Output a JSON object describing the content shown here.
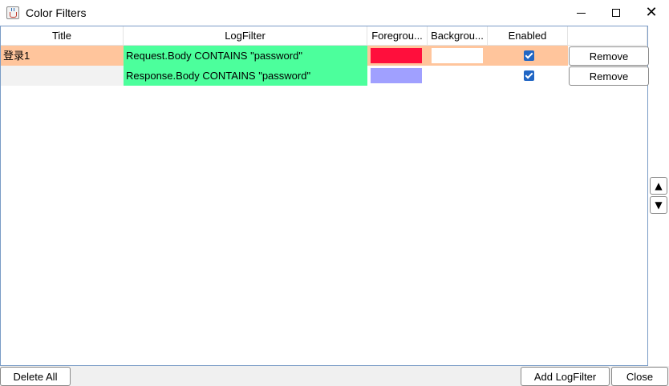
{
  "window": {
    "title": "Color Filters"
  },
  "table": {
    "columns": [
      "Title",
      "LogFilter",
      "Foregrou...",
      "Backgrou...",
      "Enabled",
      ""
    ],
    "rows": [
      {
        "title": "登录1",
        "logfilter": "Request.Body CONTAINS \"password\"",
        "foreground": "#ff0f3c",
        "background": "#ffffff",
        "enabled": true,
        "remove_label": "Remove",
        "row_color": "#ffc59c",
        "filter_color": "#4cff9c"
      },
      {
        "title": "",
        "logfilter": "Response.Body CONTAINS \"password\"",
        "foreground": "#a0a0ff",
        "background": "",
        "enabled": true,
        "remove_label": "Remove",
        "row_color": "#f2f2f2",
        "filter_color": "#4cff9c"
      }
    ]
  },
  "side_buttons": {
    "up": "▲",
    "down": "▼"
  },
  "footer": {
    "delete_all": "Delete All",
    "add_logfilter": "Add LogFilter",
    "close": "Close"
  }
}
